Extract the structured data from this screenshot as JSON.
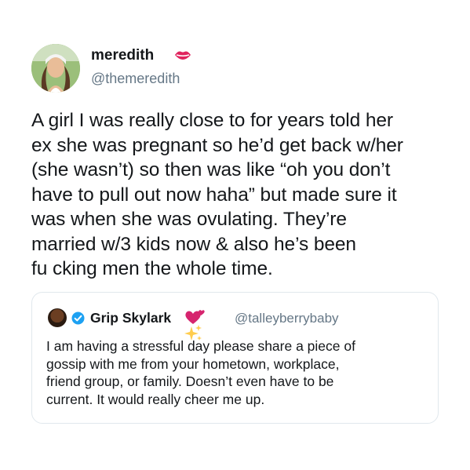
{
  "tweet": {
    "display_name": "meredith",
    "handle": "@themeredith",
    "name_emoji_icon": "lips-icon",
    "text": "A girl I was really close to for years told her\nex she was pregnant so he’d get back w/her\n(she wasn’t) so then was like “oh you don’t\nhave to pull out now haha” but made sure it\nwas when she was ovulating. They’re\nmarried w/3 kids now & also he’s been\nfu cking men the whole time."
  },
  "quoted_tweet": {
    "display_name": "Grip Skylark",
    "handle": "@talleyberrybaby",
    "verified_icon": "verified-badge-icon",
    "name_emoji_icons": [
      "two-hearts-icon",
      "sparkles-icon"
    ],
    "text": "I am having a stressful day please share a piece of\ngossip with me from your hometown, workplace,\nfriend group, or family. Doesn’t even have to be\ncurrent. It would really cheer me up."
  },
  "colors": {
    "text": "#14171a",
    "secondary": "#657786",
    "border": "#e1e8ed",
    "verified": "#1da1f2",
    "heart": "#d6246e",
    "lips": "#e0245e",
    "sparkle": "#ffcc4d"
  }
}
